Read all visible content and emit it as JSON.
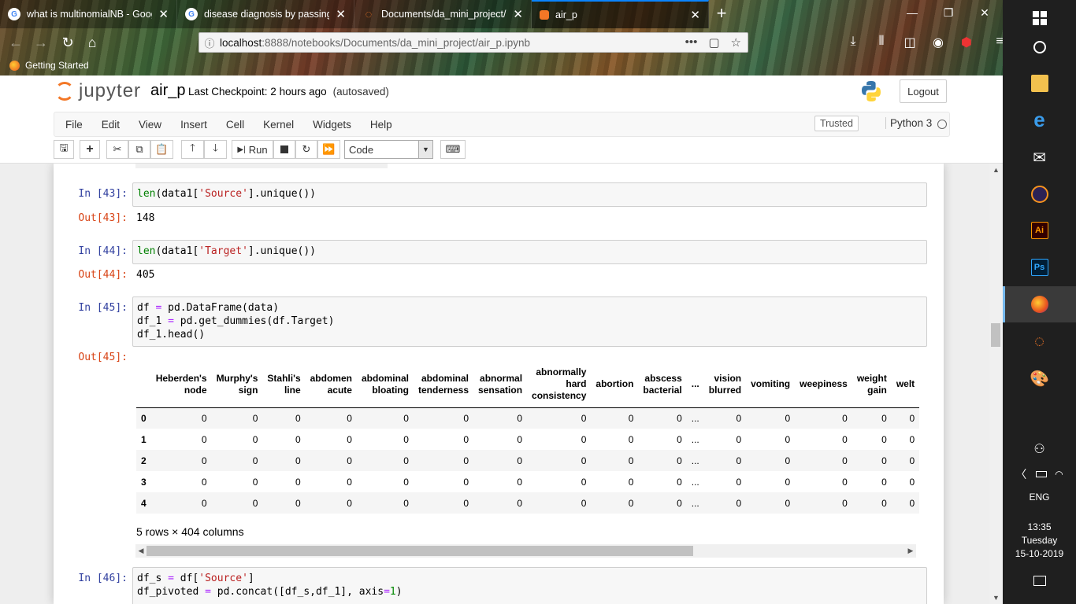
{
  "browser": {
    "tabs": [
      {
        "title": "what is multinomialNB - Google Search",
        "favicon": "google"
      },
      {
        "title": "disease diagnosis by passing symptoms",
        "favicon": "google"
      },
      {
        "title": "Documents/da_mini_project/",
        "favicon": "jupyter"
      },
      {
        "title": "air_p",
        "favicon": "jupyter-orange",
        "active": true
      }
    ],
    "url_host": "localhost",
    "url_path": ":8888/notebooks/Documents/da_mini_project/air_p.ipynb",
    "bookmark": "Getting Started"
  },
  "jupyter": {
    "logo_text": "jupyter",
    "notebook_name": "air_p",
    "checkpoint": "Last Checkpoint: 2 hours ago",
    "autosave": "(autosaved)",
    "logout": "Logout",
    "menu": [
      "File",
      "Edit",
      "View",
      "Insert",
      "Cell",
      "Kernel",
      "Widgets",
      "Help"
    ],
    "trusted": "Trusted",
    "kernel": "Python 3",
    "run_label": "Run",
    "cell_type": "Code"
  },
  "cells": {
    "c43": {
      "in_prompt": "In [43]:",
      "out_prompt": "Out[43]:",
      "output": "148"
    },
    "c44": {
      "in_prompt": "In [44]:",
      "out_prompt": "Out[44]:",
      "output": "405"
    },
    "c45": {
      "in_prompt": "In [45]:",
      "out_prompt": "Out[45]:",
      "line1": "df = pd.DataFrame(data)",
      "line2": "df_1 = pd.get_dummies(df.Target)",
      "line3": "df_1.head()"
    },
    "c46": {
      "in_prompt": "In [46]:",
      "line1": "df_s = df['Source']",
      "line2": "df_pivoted = pd.concat([df_s,df_1], axis=1)"
    }
  },
  "dataframe": {
    "columns": [
      [
        "Heberden's",
        "node"
      ],
      [
        "Murphy's",
        "sign"
      ],
      [
        "Stahli's",
        "line"
      ],
      [
        "abdomen",
        "acute"
      ],
      [
        "abdominal",
        "bloating"
      ],
      [
        "abdominal",
        "tenderness"
      ],
      [
        "abnormal",
        "sensation"
      ],
      [
        "abnormally",
        "hard",
        "consistency"
      ],
      [
        "abortion"
      ],
      [
        "abscess",
        "bacterial"
      ],
      [
        "..."
      ],
      [
        "vision",
        "blurred"
      ],
      [
        "vomiting"
      ],
      [
        "weepiness"
      ],
      [
        "weight",
        "gain"
      ],
      [
        "welt"
      ]
    ],
    "rows": [
      {
        "index": "0",
        "values": [
          "0",
          "0",
          "0",
          "0",
          "0",
          "0",
          "0",
          "0",
          "0",
          "0",
          "...",
          "0",
          "0",
          "0",
          "0",
          "0"
        ]
      },
      {
        "index": "1",
        "values": [
          "0",
          "0",
          "0",
          "0",
          "0",
          "0",
          "0",
          "0",
          "0",
          "0",
          "...",
          "0",
          "0",
          "0",
          "0",
          "0"
        ]
      },
      {
        "index": "2",
        "values": [
          "0",
          "0",
          "0",
          "0",
          "0",
          "0",
          "0",
          "0",
          "0",
          "0",
          "...",
          "0",
          "0",
          "0",
          "0",
          "0"
        ]
      },
      {
        "index": "3",
        "values": [
          "0",
          "0",
          "0",
          "0",
          "0",
          "0",
          "0",
          "0",
          "0",
          "0",
          "...",
          "0",
          "0",
          "0",
          "0",
          "0"
        ]
      },
      {
        "index": "4",
        "values": [
          "0",
          "0",
          "0",
          "0",
          "0",
          "0",
          "0",
          "0",
          "0",
          "0",
          "...",
          "0",
          "0",
          "0",
          "0",
          "0"
        ]
      }
    ],
    "shape_text": "5 rows × 404 columns"
  },
  "taskbar": {
    "language": "ENG",
    "time": "13:35",
    "day": "Tuesday",
    "date": "15-10-2019"
  },
  "colors": {
    "jupyter_orange": "#f37726",
    "in_prompt": "#303f9f",
    "out_prompt": "#d84315",
    "string": "#ba2121",
    "builtin": "#008000"
  }
}
